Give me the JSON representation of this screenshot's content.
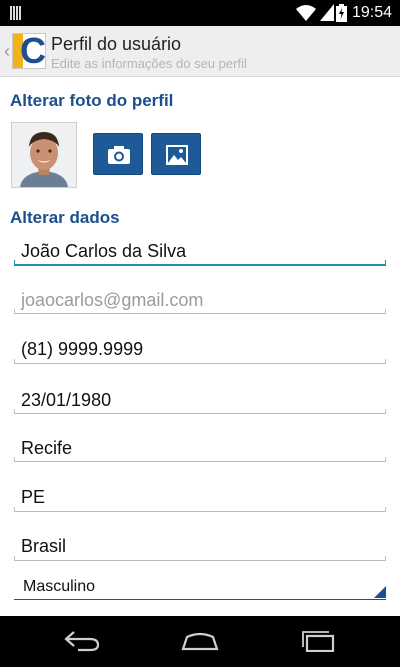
{
  "status_bar": {
    "time": "19:54"
  },
  "header": {
    "logo_letter": "C",
    "title": "Perfil do usuário",
    "subtitle": "Edite as informações do seu perfil"
  },
  "photo_section": {
    "title": "Alterar foto do perfil",
    "buttons": [
      {
        "icon": "camera-icon"
      },
      {
        "icon": "gallery-icon"
      }
    ]
  },
  "data_section": {
    "title": "Alterar dados",
    "fields": {
      "name": "João Carlos da Silva",
      "email_placeholder": "joaocarlos@gmail.com",
      "phone": "(81) 9999.9999",
      "birthdate": "23/01/1980",
      "city": "Recife",
      "state": "PE",
      "country": "Brasil"
    },
    "gender_selected": "Masculino"
  },
  "colors": {
    "accent": "#1c4f8f",
    "active_underline": "#1f8fb0",
    "logo_yellow": "#f3b21a"
  }
}
